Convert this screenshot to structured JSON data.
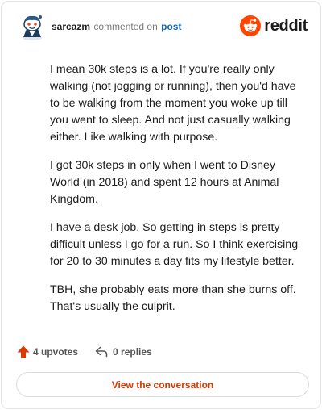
{
  "header": {
    "username": "sarcazm",
    "action_text": "commented on",
    "target_text": "post",
    "brand_name": "reddit",
    "brand_color": "#ff4500"
  },
  "comment": {
    "paragraphs": [
      "I mean 30k steps is a lot. If you're really only walking (not jogging or running), then you'd have to be walking from the moment you woke up till you went to sleep. And not just casually walking either. Like walking with purpose.",
      "I got 30k steps in only when I went to Disney World (in 2018) and spent 12 hours at Animal Kingdom.",
      "I have a desk job. So getting in steps is pretty difficult unless I go for a run. So I think exercising for 20 to 30 minutes a day fits my lifestyle better.",
      "TBH, she probably eats more than she burns off. That's usually the culprit."
    ]
  },
  "footer": {
    "upvotes_label": "4 upvotes",
    "replies_label": "0 replies",
    "view_button_label": "View the conversation",
    "upvote_icon": "upvote-arrow-icon",
    "reply_icon": "reply-arrow-icon",
    "accent_color": "#d93a00"
  }
}
